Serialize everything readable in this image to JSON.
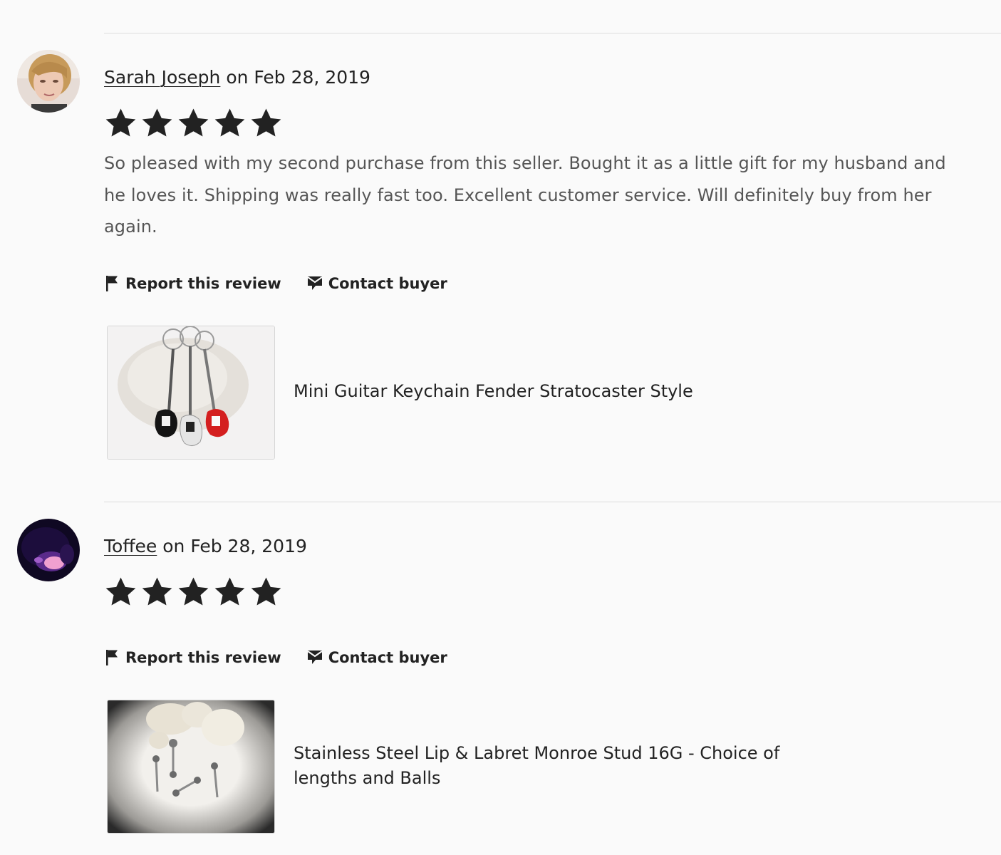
{
  "reviews": [
    {
      "reviewer": "Sarah Joseph",
      "date_text": "on Feb 28, 2019",
      "rating": 5,
      "text": "So pleased with my second purchase from this seller. Bought it as a little gift for my husband and he loves it. Shipping was really fast too. Excellent customer service. Will definitely buy from her again.",
      "actions": {
        "report": "Report this review",
        "contact": "Contact buyer"
      },
      "product": {
        "title": "Mini Guitar Keychain Fender Stratocaster Style"
      }
    },
    {
      "reviewer": "Toffee",
      "date_text": "on Feb 28, 2019",
      "rating": 5,
      "text": "",
      "actions": {
        "report": "Report this review",
        "contact": "Contact buyer"
      },
      "product": {
        "title": "Stainless Steel Lip & Labret Monroe Stud 16G - Choice of lengths and Balls"
      }
    }
  ],
  "colors": {
    "text_primary": "#222222",
    "text_secondary": "#555555",
    "divider": "#dcdcdc",
    "background": "#fafafa",
    "star": "#222222"
  },
  "icons": {
    "rating": "star-icon",
    "report": "flag-icon",
    "contact": "message-icon"
  }
}
